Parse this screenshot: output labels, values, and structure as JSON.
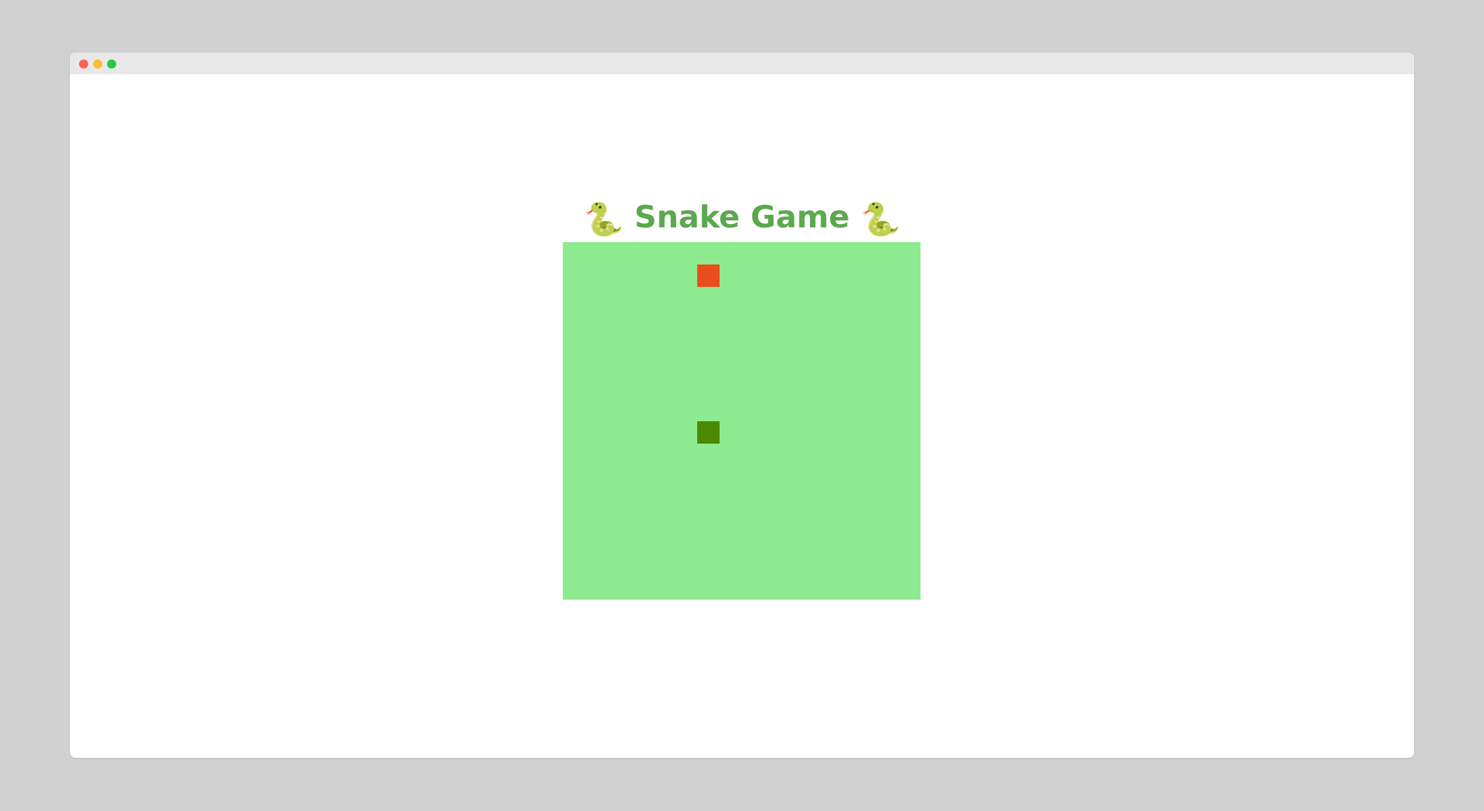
{
  "window": {
    "controls": [
      "close",
      "minimize",
      "maximize"
    ]
  },
  "game": {
    "title_left_icon": "🐍",
    "title": "Snake Game",
    "title_right_icon": "🐍",
    "board": {
      "cols": 16,
      "rows": 16,
      "background": "#8feb8f",
      "food": {
        "col": 6,
        "row": 1,
        "color": "#ea4d1c"
      },
      "snake": [
        {
          "col": 6,
          "row": 8
        }
      ],
      "snake_color": "#4b8a00"
    },
    "title_color": "#5ba84f"
  }
}
